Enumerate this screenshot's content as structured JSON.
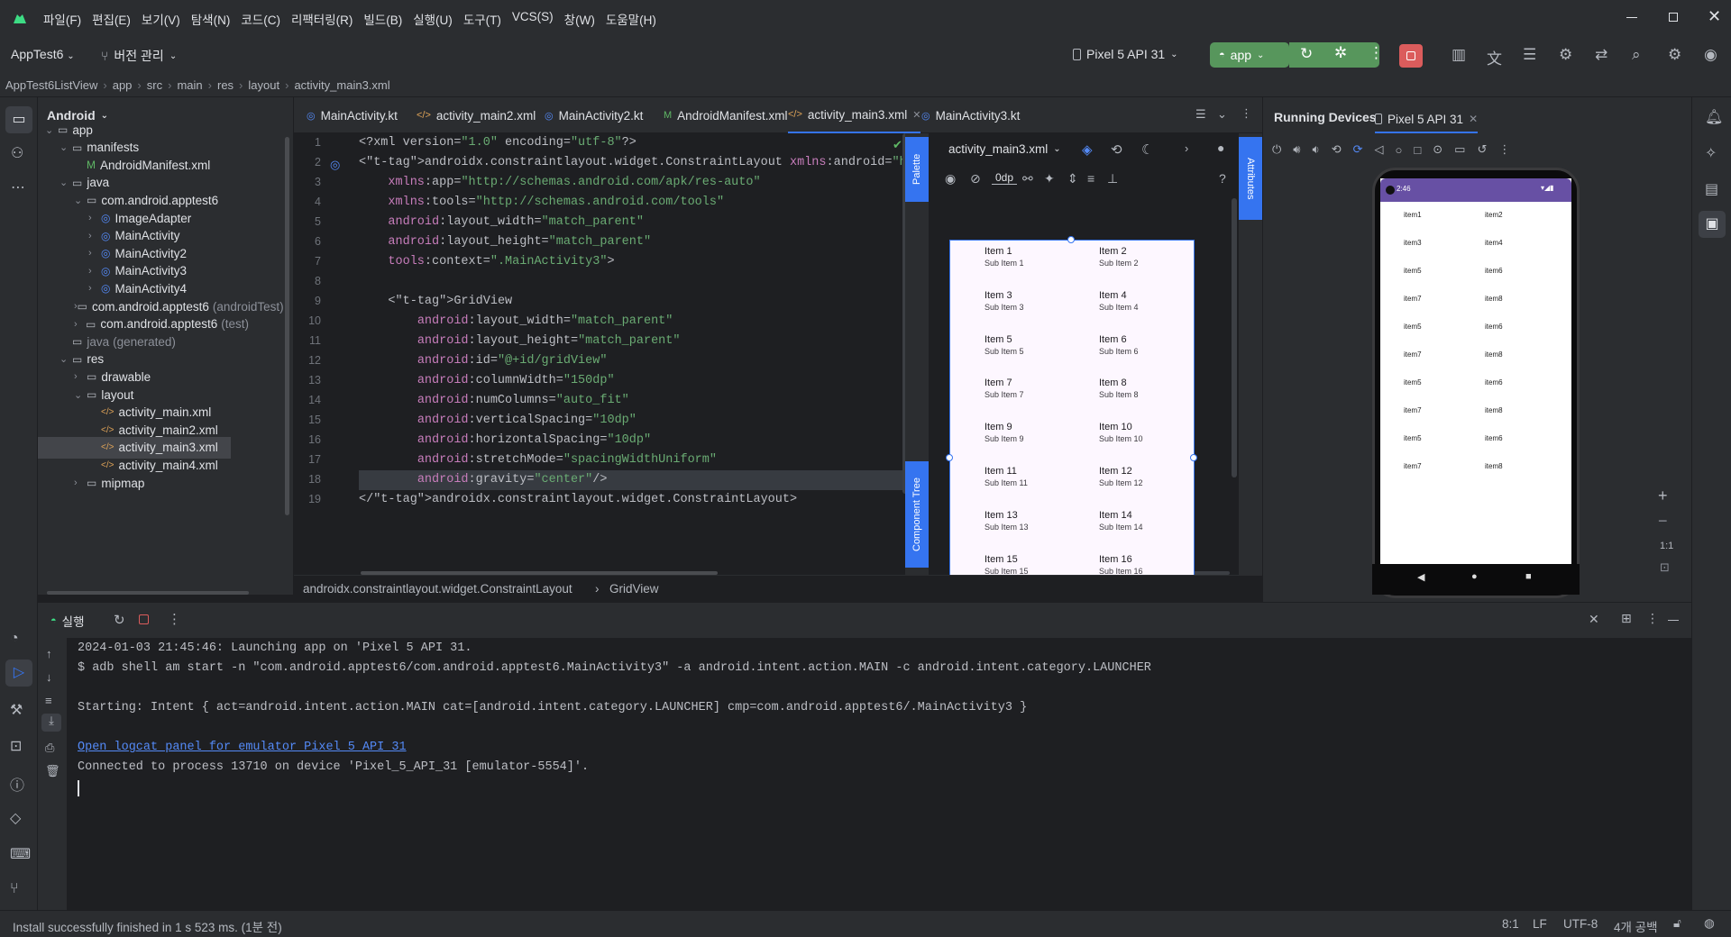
{
  "menu": [
    "파일(F)",
    "편집(E)",
    "보기(V)",
    "탐색(N)",
    "코드(C)",
    "리팩터링(R)",
    "빌드(B)",
    "실행(U)",
    "도구(T)",
    "VCS(S)",
    "창(W)",
    "도움말(H)"
  ],
  "toolbar": {
    "project": "AppTest6",
    "vcs": "버전 관리",
    "device": "Pixel 5 API 31",
    "run_config": "app"
  },
  "breadcrumb": [
    "AppTest6ListView",
    "app",
    "src",
    "main",
    "res",
    "layout",
    "activity_main3.xml"
  ],
  "project_panel": {
    "title": "Android",
    "tree": [
      {
        "label": "app",
        "depth": 0,
        "icon": "module"
      },
      {
        "label": "manifests",
        "depth": 1,
        "icon": "folder"
      },
      {
        "label": "AndroidManifest.xml",
        "depth": 2,
        "icon": "manifest"
      },
      {
        "label": "java",
        "depth": 1,
        "icon": "folder"
      },
      {
        "label": "com.android.apptest6",
        "depth": 2,
        "icon": "package"
      },
      {
        "label": "ImageAdapter",
        "depth": 3,
        "icon": "class"
      },
      {
        "label": "MainActivity",
        "depth": 3,
        "icon": "class"
      },
      {
        "label": "MainActivity2",
        "depth": 3,
        "icon": "class"
      },
      {
        "label": "MainActivity3",
        "depth": 3,
        "icon": "class"
      },
      {
        "label": "MainActivity4",
        "depth": 3,
        "icon": "class"
      },
      {
        "label": "com.android.apptest6",
        "suffix": "(androidTest)",
        "depth": 2,
        "icon": "package"
      },
      {
        "label": "com.android.apptest6",
        "suffix": "(test)",
        "depth": 2,
        "icon": "package"
      },
      {
        "label": "java",
        "suffix": "(generated)",
        "depth": 1,
        "icon": "folder"
      },
      {
        "label": "res",
        "depth": 1,
        "icon": "folder"
      },
      {
        "label": "drawable",
        "depth": 2,
        "icon": "folder"
      },
      {
        "label": "layout",
        "depth": 2,
        "icon": "folder"
      },
      {
        "label": "activity_main.xml",
        "depth": 3,
        "icon": "xml"
      },
      {
        "label": "activity_main2.xml",
        "depth": 3,
        "icon": "xml"
      },
      {
        "label": "activity_main3.xml",
        "depth": 3,
        "icon": "xml"
      },
      {
        "label": "activity_main4.xml",
        "depth": 3,
        "icon": "xml"
      },
      {
        "label": "mipmap",
        "depth": 2,
        "icon": "folder"
      }
    ]
  },
  "tabs": [
    "MainActivity.kt",
    "activity_main2.xml",
    "MainActivity2.kt",
    "AndroidManifest.xml",
    "activity_main3.xml",
    "MainActivity3.kt"
  ],
  "active_tab": "activity_main3.xml",
  "code_lines": [
    "<?xml version=\"1.0\" encoding=\"utf-8\"?>",
    "<androidx.constraintlayout.widget.ConstraintLayout xmlns:android=\"http://schemas.android.com/apk/res/android\"",
    "    xmlns:app=\"http://schemas.android.com/apk/res-auto\"",
    "    xmlns:tools=\"http://schemas.android.com/tools\"",
    "    android:layout_width=\"match_parent\"",
    "    android:layout_height=\"match_parent\"",
    "    tools:context=\".MainActivity3\">",
    "",
    "    <GridView",
    "        android:layout_width=\"match_parent\"",
    "        android:layout_height=\"match_parent\"",
    "        android:id=\"@+id/gridView\"",
    "        android:columnWidth=\"150dp\"",
    "        android:numColumns=\"auto_fit\"",
    "        android:verticalSpacing=\"10dp\"",
    "        android:horizontalSpacing=\"10dp\"",
    "        android:stretchMode=\"spacingWidthUniform\"",
    "        android:gravity=\"center\"/>",
    "</androidx.constraintlayout.widget.ConstraintLayout>"
  ],
  "editor_breadcrumb": [
    "androidx.constraintlayout.widget.ConstraintLayout",
    "GridView"
  ],
  "design": {
    "file": "activity_main3.xml",
    "margin": "0dp",
    "palette": "Palette",
    "component_tree": "Component Tree",
    "attributes": "Attributes",
    "items": [
      [
        "Item 1",
        "Sub Item 1"
      ],
      [
        "Item 2",
        "Sub Item 2"
      ],
      [
        "Item 3",
        "Sub Item 3"
      ],
      [
        "Item 4",
        "Sub Item 4"
      ],
      [
        "Item 5",
        "Sub Item 5"
      ],
      [
        "Item 6",
        "Sub Item 6"
      ],
      [
        "Item 7",
        "Sub Item 7"
      ],
      [
        "Item 8",
        "Sub Item 8"
      ],
      [
        "Item 9",
        "Sub Item 9"
      ],
      [
        "Item 10",
        "Sub Item 10"
      ],
      [
        "Item 11",
        "Sub Item 11"
      ],
      [
        "Item 12",
        "Sub Item 12"
      ],
      [
        "Item 13",
        "Sub Item 13"
      ],
      [
        "Item 14",
        "Sub Item 14"
      ],
      [
        "Item 15",
        "Sub Item 15"
      ],
      [
        "Item 16",
        "Sub Item 16"
      ]
    ]
  },
  "running": {
    "title": "Running Devices",
    "device_tab": "Pixel 5 API 31",
    "zoom": "1:1",
    "clock": "2:46",
    "phone_items": [
      "item1",
      "item2",
      "item3",
      "item4",
      "item5",
      "item6",
      "item7",
      "item8",
      "item5",
      "item6",
      "item7",
      "item8",
      "item5",
      "item6",
      "item7",
      "item8",
      "item5",
      "item6",
      "item7",
      "item8"
    ]
  },
  "run": {
    "title": "실행",
    "lines": [
      "2024-01-03 21:45:46: Launching app on 'Pixel 5 API 31.",
      "$ adb shell am start -n \"com.android.apptest6/com.android.apptest6.MainActivity3\" -a android.intent.action.MAIN -c android.intent.category.LAUNCHER",
      "",
      "Starting: Intent { act=android.intent.action.MAIN cat=[android.intent.category.LAUNCHER] cmp=com.android.apptest6/.MainActivity3 }",
      "",
      "Open logcat panel for emulator Pixel 5 API 31",
      "Connected to process 13710 on device 'Pixel_5_API_31 [emulator-5554]'."
    ],
    "link_line": 5
  },
  "status": {
    "message": "Install successfully finished in 1 s 523 ms. (1분 전)",
    "position": "8:1",
    "line_sep": "LF",
    "encoding": "UTF-8",
    "indent": "4개 공백"
  },
  "colors": {
    "accent": "#3574f0",
    "run_green": "#57965c",
    "stop_red": "#db5c5c"
  }
}
